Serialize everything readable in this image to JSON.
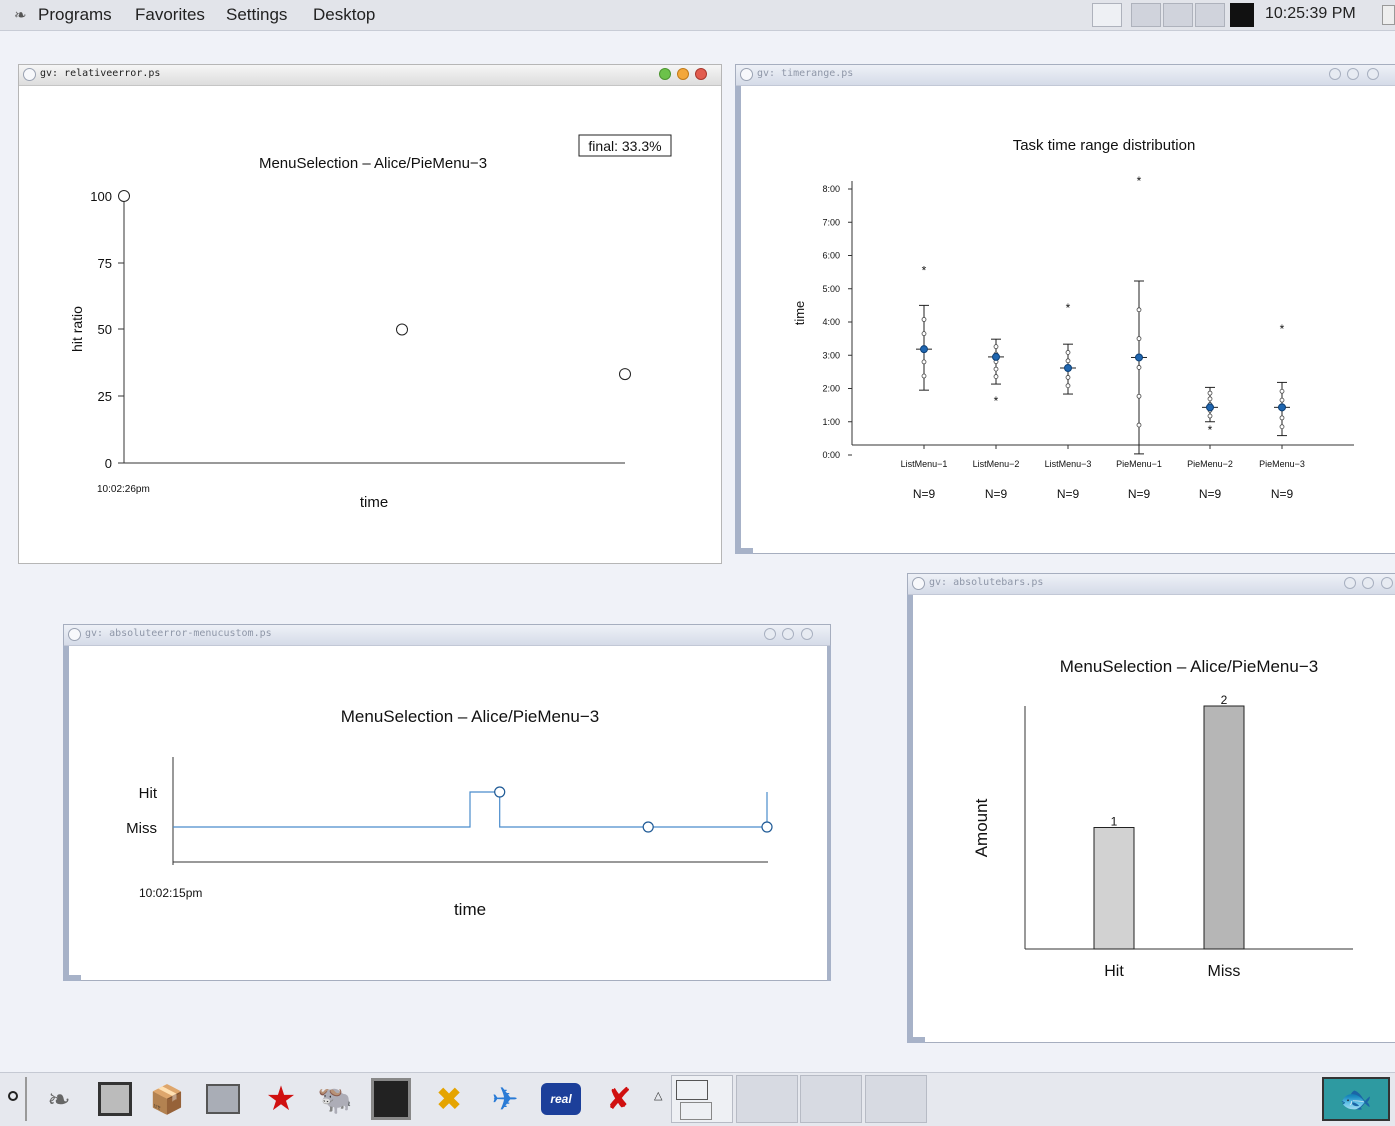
{
  "desktop": {
    "menu": [
      "Programs",
      "Favorites",
      "Settings",
      "Desktop"
    ],
    "clock": "10:25:39 PM"
  },
  "windows": {
    "relativeerror": {
      "title": "gv: relativeerror.ps",
      "final_label": "final: 33.3%",
      "chart_title": "MenuSelection – Alice/PieMenu−3",
      "xlabel": "time",
      "ylabel": "hit ratio",
      "x_start": "10:02:26pm",
      "yticks": [
        "100",
        "75",
        "50",
        "25",
        "0"
      ]
    },
    "timerange": {
      "title": "gv: timerange.ps",
      "chart_title": "Task time range distribution",
      "ylabel": "time",
      "yticks": [
        "8:00",
        "7:00",
        "6:00",
        "5:00",
        "4:00",
        "3:00",
        "2:00",
        "1:00",
        "0:00"
      ],
      "categories": [
        "ListMenu−1",
        "ListMenu−2",
        "ListMenu−3",
        "PieMenu−1",
        "PieMenu−2",
        "PieMenu−3"
      ],
      "counts": [
        "N=9",
        "N=9",
        "N=9",
        "N=9",
        "N=9",
        "N=9"
      ]
    },
    "absoluteerror": {
      "title": "gv: absoluteerror-menucustom.ps",
      "chart_title": "MenuSelection – Alice/PieMenu−3",
      "xlabel": "time",
      "x_start": "10:02:15pm",
      "levels": [
        "Hit",
        "Miss"
      ]
    },
    "absolutebars": {
      "title": "gv: absolutebars.ps",
      "chart_title": "MenuSelection – Alice/PieMenu−3",
      "ylabel": "Amount",
      "categories": [
        "Hit",
        "Miss"
      ],
      "value_labels": [
        "1",
        "2"
      ]
    }
  },
  "chart_data": [
    {
      "type": "scatter",
      "title": "MenuSelection – Alice/PieMenu−3",
      "xlabel": "time",
      "ylabel": "hit ratio",
      "ylim": [
        0,
        100
      ],
      "x_start_label": "10:02:26pm",
      "y": [
        100,
        50,
        33.3
      ],
      "annotation": "final: 33.3%"
    },
    {
      "type": "scatter",
      "title": "Task time range distribution",
      "ylabel": "time",
      "ylim_minutes": [
        0,
        480
      ],
      "categories": [
        "ListMenu−1",
        "ListMenu−2",
        "ListMenu−3",
        "PieMenu−1",
        "PieMenu−2",
        "PieMenu−3"
      ],
      "series": [
        {
          "name": "mean",
          "values": [
            191,
            177,
            157,
            176,
            86,
            86
          ]
        },
        {
          "name": "whisker_low",
          "values": [
            117,
            128,
            110,
            2,
            60,
            35
          ]
        },
        {
          "name": "whisker_high",
          "values": [
            270,
            209,
            200,
            314,
            122,
            131
          ]
        },
        {
          "name": "outlier",
          "values": [
            335,
            99,
            267,
            496,
            47,
            229
          ]
        }
      ],
      "counts": [
        "N=9",
        "N=9",
        "N=9",
        "N=9",
        "N=9",
        "N=9"
      ]
    },
    {
      "type": "line",
      "title": "MenuSelection – Alice/PieMenu−3",
      "xlabel": "time",
      "x_start_label": "10:02:15pm",
      "levels": [
        "Hit",
        "Miss"
      ],
      "step_series": [
        {
          "x": 0.0,
          "state": "Miss"
        },
        {
          "x": 0.5,
          "state": "Hit"
        },
        {
          "x": 0.55,
          "state": "Miss"
        },
        {
          "x": 0.8,
          "state": "Miss"
        },
        {
          "x": 1.0,
          "state": "Miss"
        }
      ],
      "markers_x": [
        0.55,
        0.8,
        1.0
      ]
    },
    {
      "type": "bar",
      "title": "MenuSelection – Alice/PieMenu−3",
      "ylabel": "Amount",
      "categories": [
        "Hit",
        "Miss"
      ],
      "values": [
        1,
        2
      ],
      "colors": [
        "#d2d2d2",
        "#b6b6b6"
      ],
      "ylim": [
        0,
        2
      ]
    }
  ]
}
